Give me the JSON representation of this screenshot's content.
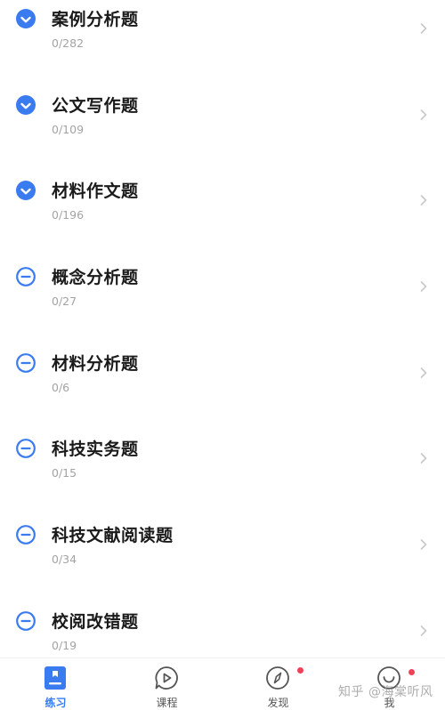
{
  "colors": {
    "accent": "#3a7bf0",
    "title_text": "#1a1a1a",
    "sub_text": "#a3a3a3",
    "badge_red": "#ee4357"
  },
  "items": [
    {
      "title": "案例分析题",
      "progress": "0/282",
      "icon": "check-circle-icon"
    },
    {
      "title": "公文写作题",
      "progress": "0/109",
      "icon": "check-circle-icon"
    },
    {
      "title": "材料作文题",
      "progress": "0/196",
      "icon": "check-circle-icon"
    },
    {
      "title": "概念分析题",
      "progress": "0/27",
      "icon": "minus-circle-icon"
    },
    {
      "title": "材料分析题",
      "progress": "0/6",
      "icon": "minus-circle-icon"
    },
    {
      "title": "科技实务题",
      "progress": "0/15",
      "icon": "minus-circle-icon"
    },
    {
      "title": "科技文献阅读题",
      "progress": "0/34",
      "icon": "minus-circle-icon"
    },
    {
      "title": "校阅改错题",
      "progress": "0/19",
      "icon": "minus-circle-icon"
    }
  ],
  "tabbar": {
    "tabs": [
      {
        "label": "练习",
        "icon": "practice-book-icon",
        "active": true,
        "badge": false
      },
      {
        "label": "课程",
        "icon": "play-bubble-icon",
        "active": false,
        "badge": false
      },
      {
        "label": "发现",
        "icon": "compass-icon",
        "active": false,
        "badge": true
      },
      {
        "label": "我",
        "icon": "smile-face-icon",
        "active": false,
        "badge": true
      }
    ]
  },
  "watermark": "知乎 @海棠听风"
}
